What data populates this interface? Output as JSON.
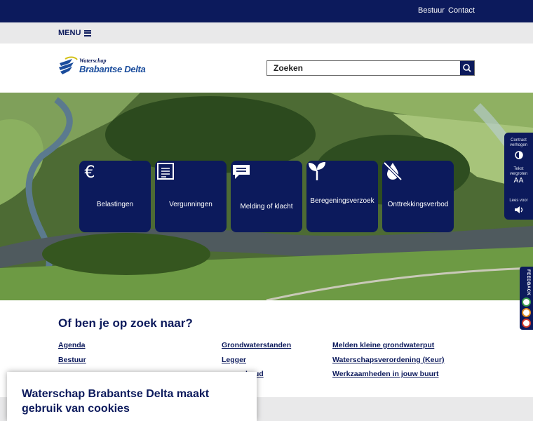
{
  "topbar": {
    "links": [
      "Bestuur",
      "Contact"
    ]
  },
  "menubar": {
    "menu_label": "MENU"
  },
  "header": {
    "logo_small": "Waterschap",
    "logo_big": "Brabantse Delta",
    "search_placeholder": "Zoeken"
  },
  "tiles": [
    {
      "label": "Belastingen",
      "icon": "euro-icon"
    },
    {
      "label": "Vergunningen",
      "icon": "form-icon"
    },
    {
      "label": "Melding of klacht",
      "icon": "chat-icon"
    },
    {
      "label": "Beregeningsverzoek",
      "icon": "sprout-icon"
    },
    {
      "label": "Onttrekkingsverbod",
      "icon": "no-water-icon"
    }
  ],
  "side_tools": [
    {
      "label": "Contrast verhogen",
      "icon": "contrast-icon"
    },
    {
      "label": "Tekst vergroten",
      "icon": "text-size-icon",
      "glyph": "AA"
    },
    {
      "label": "Lees voor",
      "icon": "speaker-icon"
    }
  ],
  "feedback": {
    "label": "FEEDBACK"
  },
  "search_section": {
    "title": "Of ben je op zoek naar?",
    "links": [
      "Agenda",
      "Bestuur",
      "Grondwaterstanden",
      "Legger",
      "houd",
      "Melden kleine grondwaterput",
      "Waterschapsverordening (Keur)",
      "Werkzaamheden in jouw buurt"
    ]
  },
  "cookie": {
    "title": "Waterschap Brabantse Delta maakt gebruik van cookies"
  },
  "colors": {
    "navy": "#0c1a5c",
    "grey": "#e9e9ea",
    "logo_blue": "#1a4c9c"
  }
}
